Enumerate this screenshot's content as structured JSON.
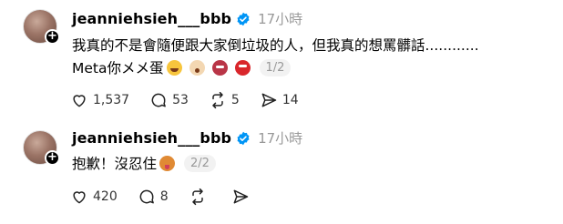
{
  "posts": [
    {
      "username": "jeanniehsieh___bbb",
      "time": "17小時",
      "text_line1": "我真的不是會隨便跟大家倒垃圾的人，但我真的想罵髒話............",
      "text_line2": "Meta你メメ蛋",
      "emojis": [
        "laughing-face-icon",
        "shocked-face-icon",
        "devil-face-icon",
        "angry-face-icon"
      ],
      "pager": "1/2",
      "likes": "1,537",
      "comments": "53",
      "reposts": "5",
      "shares": "14"
    },
    {
      "username": "jeanniehsieh___bbb",
      "time": "17小時",
      "text_line1": "抱歉！沒忍住",
      "emojis": [
        "tongue-face-icon"
      ],
      "pager": "2/2",
      "likes": "420",
      "comments": "8"
    }
  ],
  "colors": {
    "verified": "#0095f6",
    "muted": "#999999"
  }
}
